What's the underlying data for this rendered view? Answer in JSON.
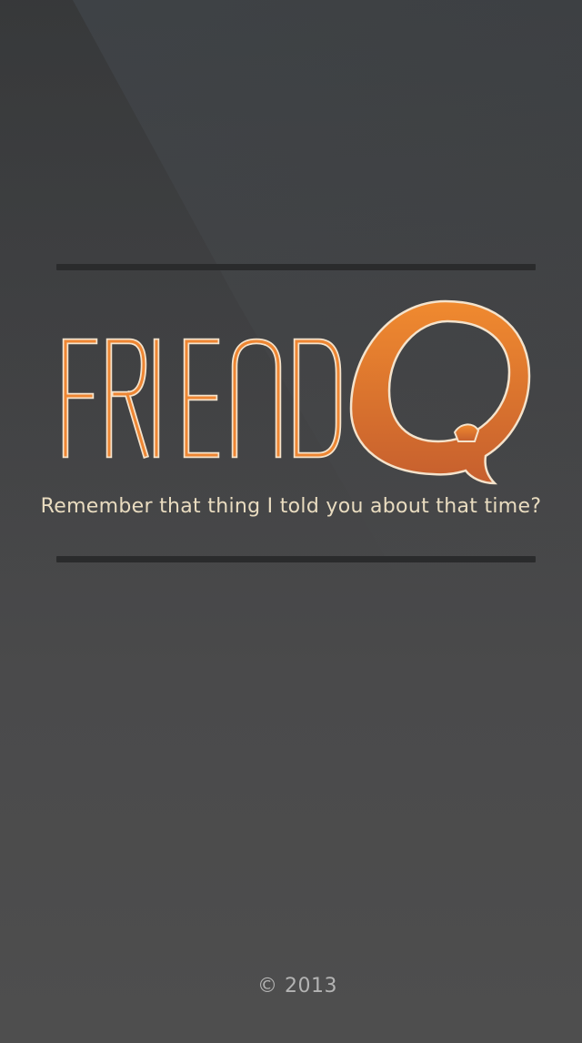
{
  "app": {
    "logo_text": "FRIENDQ",
    "logo_word": "FRIEND",
    "logo_q": "Q",
    "tagline": "Remember that thing I told you about that time?",
    "copyright": "© 2013"
  },
  "colors": {
    "accent_orange": "#ee8633",
    "accent_orange_dark": "#c9622b",
    "tagline_color": "#e9dcc0",
    "copyright_color": "#b3b3b3",
    "divider_color": "#2a2b2c"
  }
}
